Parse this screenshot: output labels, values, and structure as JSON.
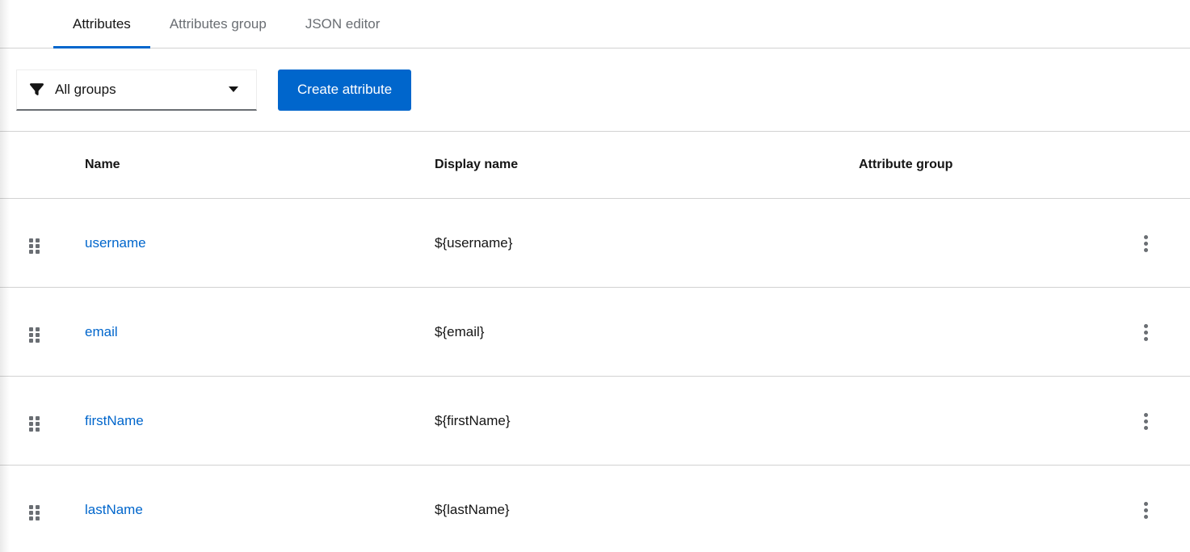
{
  "tabs": [
    {
      "label": "Attributes",
      "active": true
    },
    {
      "label": "Attributes group",
      "active": false
    },
    {
      "label": "JSON editor",
      "active": false
    }
  ],
  "toolbar": {
    "filter": {
      "value": "All groups",
      "icon": "filter-icon",
      "caret_icon": "caret-down-icon"
    },
    "create_button": "Create attribute"
  },
  "table": {
    "columns": [
      "Name",
      "Display name",
      "Attribute group"
    ],
    "row_icons": {
      "left": "grip-vertical-icon",
      "right": "kebab-icon"
    },
    "rows": [
      {
        "name": "username",
        "display_name": "${username}",
        "attribute_group": ""
      },
      {
        "name": "email",
        "display_name": "${email}",
        "attribute_group": ""
      },
      {
        "name": "firstName",
        "display_name": "${firstName}",
        "attribute_group": ""
      },
      {
        "name": "lastName",
        "display_name": "${lastName}",
        "attribute_group": ""
      }
    ]
  },
  "colors": {
    "accent": "#0066cc",
    "link": "#0066cc",
    "button_bg": "#0066cc",
    "text_primary": "#151515",
    "text_secondary": "#6a6e73",
    "border": "#d2d2d2",
    "icon_gray": "#6a6e73"
  }
}
